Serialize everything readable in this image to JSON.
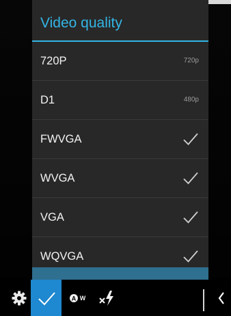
{
  "dialog": {
    "title": "Video quality",
    "items": [
      {
        "label": "720P",
        "detail": "720p",
        "checked": false
      },
      {
        "label": "D1",
        "detail": "480p",
        "checked": false
      },
      {
        "label": "FWVGA",
        "detail": "",
        "checked": true
      },
      {
        "label": "WVGA",
        "detail": "",
        "checked": true
      },
      {
        "label": "VGA",
        "detail": "",
        "checked": true
      },
      {
        "label": "WQVGA",
        "detail": "",
        "checked": true
      }
    ]
  },
  "toolbar": {
    "auto_white_balance_label": "AW",
    "icons": [
      "gear-icon",
      "checkmark-icon",
      "auto-white-balance-icon",
      "flash-off-icon",
      "chevron-left-icon"
    ]
  },
  "colors": {
    "accent": "#33b5e5",
    "selected_button": "#1e88d0",
    "dialog_bg": "#282828"
  }
}
